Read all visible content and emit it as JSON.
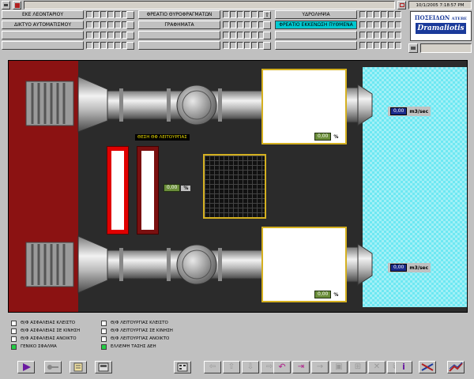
{
  "header": {
    "datetime": "10/1/2005 7:18:57 PM",
    "nav": {
      "col1": [
        "ΕΚΕ ΛΕΟΝΤΑΡΙΟΥ",
        "ΔΙΚΤΥΟ ΑΥΤΟΜΑΤΙΣΜΟΥ",
        "",
        ""
      ],
      "col2": [
        "ΦΡΕΑΤΙΟ ΘΥΡΟΦΡΑΓΜΑΤΩΝ",
        "ΓΡΑΦΗΜΑΤΑ",
        "",
        ""
      ],
      "col3": [
        "ΥΔΡΟΛΗΨΙΑ",
        "ΦΡΕΑΤΙΟ ΕΚΚΕΝΩΣΗ ΠΥΘΜΕΝΑ",
        "",
        ""
      ]
    },
    "active_nav": "ΦΡΕΑΤΙΟ ΕΚΚΕΝΩΣΗ ΠΥΘΜΕΝΑ",
    "logo": {
      "line1": "ΠΟΣΕΙΔΩΝ",
      "line1_suffix": "ΑΤΕΒΕ",
      "line2": "Dramaliotis"
    }
  },
  "diagram": {
    "position_title": "ΘΕΣΗ ΘΦ ΛΕΙΤΟΥΡΓΙΑΣ",
    "position_value": "0,00",
    "position_unit": "%",
    "valve_top_value": "0,00",
    "valve_top_unit": "%",
    "valve_bottom_value": "0,00",
    "valve_bottom_unit": "%",
    "flow_top_value": "0,00",
    "flow_top_unit": "m3/sec",
    "flow_bottom_value": "0,00",
    "flow_bottom_unit": "m3/sec"
  },
  "legend": {
    "left": [
      {
        "label": "Θ/Φ ΑΣΦΑΛΕΙΑΣ ΚΛΕΙΣΤΟ",
        "color": "#ffffff"
      },
      {
        "label": "Θ/Φ ΑΣΦΑΛΕΙΑΣ ΣΕ ΚΙΝΗΣΗ",
        "color": "#ffffff"
      },
      {
        "label": "Θ/Φ ΑΣΦΑΛΕΙΑΣ ΑΝΟΙΚΤΟ",
        "color": "#ffffff"
      },
      {
        "label": "ΓΕΝΙΚΟ ΣΦΑΛΜΑ",
        "color": "#22cc44"
      }
    ],
    "right": [
      {
        "label": "Θ/Φ ΛΕΙΤΟΥΡΓΙΑΣ ΚΛΕΙΣΤΟ",
        "color": "#ffffff"
      },
      {
        "label": "Θ/Φ ΛΕΙΤΟΥΡΓΙΑΣ ΣΕ ΚΙΝΗΣΗ",
        "color": "#ffffff"
      },
      {
        "label": "Θ/Φ ΛΕΙΤΟΥΡΓΙΑΣ ΑΝΟΙΚΤΟ",
        "color": "#ffffff"
      },
      {
        "label": "ΕΛΛΕΙΨΗ ΤΑΣΗΣ ΔΕΗ",
        "color": "#22cc44"
      }
    ]
  },
  "colors": {
    "wall_red": "#8b1212",
    "pit_dark": "#2b2b2b",
    "water": "#6ee8f2",
    "active_nav_bg": "#00c8d0"
  }
}
